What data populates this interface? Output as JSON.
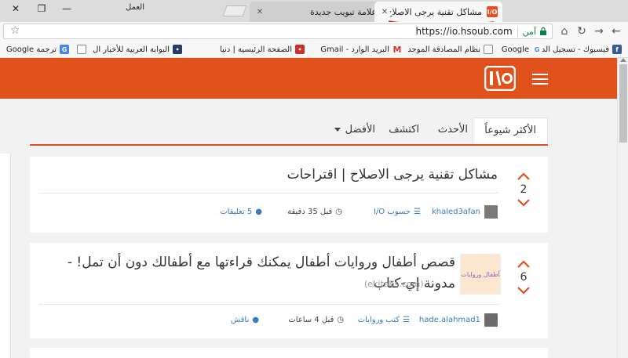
{
  "browser": {
    "profile_label": "العمل",
    "tabs": [
      {
        "title": "مشاكل تقنية يرجى الاصلاح",
        "favicon": "I/O",
        "active": true
      },
      {
        "title": "علامة تبويب جديدة",
        "active": false
      }
    ],
    "address": {
      "secure_label": "آمن",
      "url": "https://io.hsoub.com"
    },
    "bookmarks": [
      {
        "label": "فيسبوك - تسجيل الدخ",
        "icon": "facebook-icon",
        "color": "#3b5998"
      },
      {
        "label": "Google",
        "icon": "google-icon",
        "color": "#4285f4"
      },
      {
        "label": "نظام المصادقة الموحد",
        "icon": "page-icon",
        "color": "#888888"
      },
      {
        "label": "البريد الوارد - Gmail",
        "icon": "gmail-icon",
        "color": "#d93025"
      },
      {
        "label": "الصفحة الرئيسية | دنيا",
        "icon": "site-icon",
        "color": "#c9302c"
      },
      {
        "label": "البوابة العربية للأخبار ال",
        "icon": "news-icon",
        "color": "#2b3a67"
      },
      {
        "label": "",
        "icon": "page-icon",
        "color": "#888888"
      },
      {
        "label": "ترجمة Google",
        "icon": "translate-icon",
        "color": "#4285f4"
      }
    ]
  },
  "site": {
    "logo_text": "I/O",
    "brand_color": "#e0511b",
    "filters": [
      {
        "label": "الأكثر شيوعاً",
        "active": true
      },
      {
        "label": "الأحدث",
        "active": false
      },
      {
        "label": "اكتشف",
        "active": false
      },
      {
        "label": "الأفضل",
        "active": false,
        "dropdown": true
      }
    ]
  },
  "posts": [
    {
      "votes": "2",
      "title": "مشاكل تقنية يرجى الاصلاح | اقتراحات",
      "author": "khaled3afan",
      "community": "حسوب I/O",
      "time": "قبل 35 دقيقة",
      "comments": "5 تعليقات"
    },
    {
      "votes": "6",
      "title": "قصص أطفال وروايات أطفال يمكنك قراءتها مع أطفالك دون أن تمل! - مدونة إي-كتاب",
      "domain": "(ekitabs.com)",
      "thumbnail_text": "أطفال وروايات",
      "author": "hade.alahmad1",
      "community": "كتب وروايات",
      "time": "قبل 4 ساعات",
      "comments": "ناقش"
    }
  ]
}
